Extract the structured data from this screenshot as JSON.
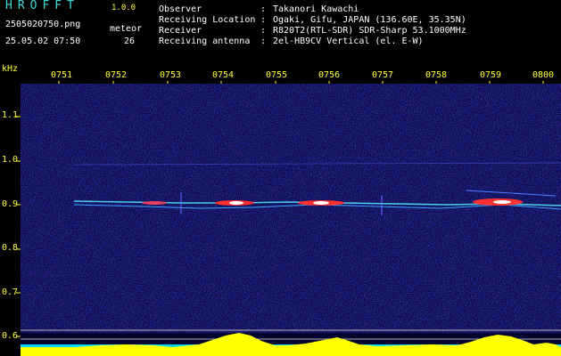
{
  "app": {
    "title": "HROFFT",
    "version": "1.0.0"
  },
  "file": {
    "name": "2505020750.png",
    "datetime": "25.05.02 07:50"
  },
  "meteor": {
    "label": "meteor",
    "count": "26"
  },
  "info": [
    {
      "key": "Observer",
      "value": "Takanori Kawachi"
    },
    {
      "key": "Receiving Location",
      "value": "Ogaki, Gifu, JAPAN (136.60E, 35.35N)"
    },
    {
      "key": "Receiver",
      "value": "R820T2(RTL-SDR) SDR-Sharp 53.1000MHz"
    },
    {
      "key": "Receiving antenna",
      "value": "2el-HB9CV Vertical (el. E-W)"
    }
  ],
  "info_sep": ":",
  "axis": {
    "unit": "kHz",
    "freq_ticks": [
      "1.1",
      "1.0",
      "0.9",
      "0.8",
      "0.7",
      "0.6"
    ],
    "time_ticks": [
      "0751",
      "0752",
      "0753",
      "0754",
      "0755",
      "0756",
      "0757",
      "0758",
      "0759",
      "0800"
    ]
  },
  "colors": {
    "background": "#000000",
    "noise_floor": "#0a0a5a",
    "label": "#ffff3a",
    "header": "#3fd8d8",
    "signal": "#ffff00",
    "baseline": "#00ffff"
  }
}
